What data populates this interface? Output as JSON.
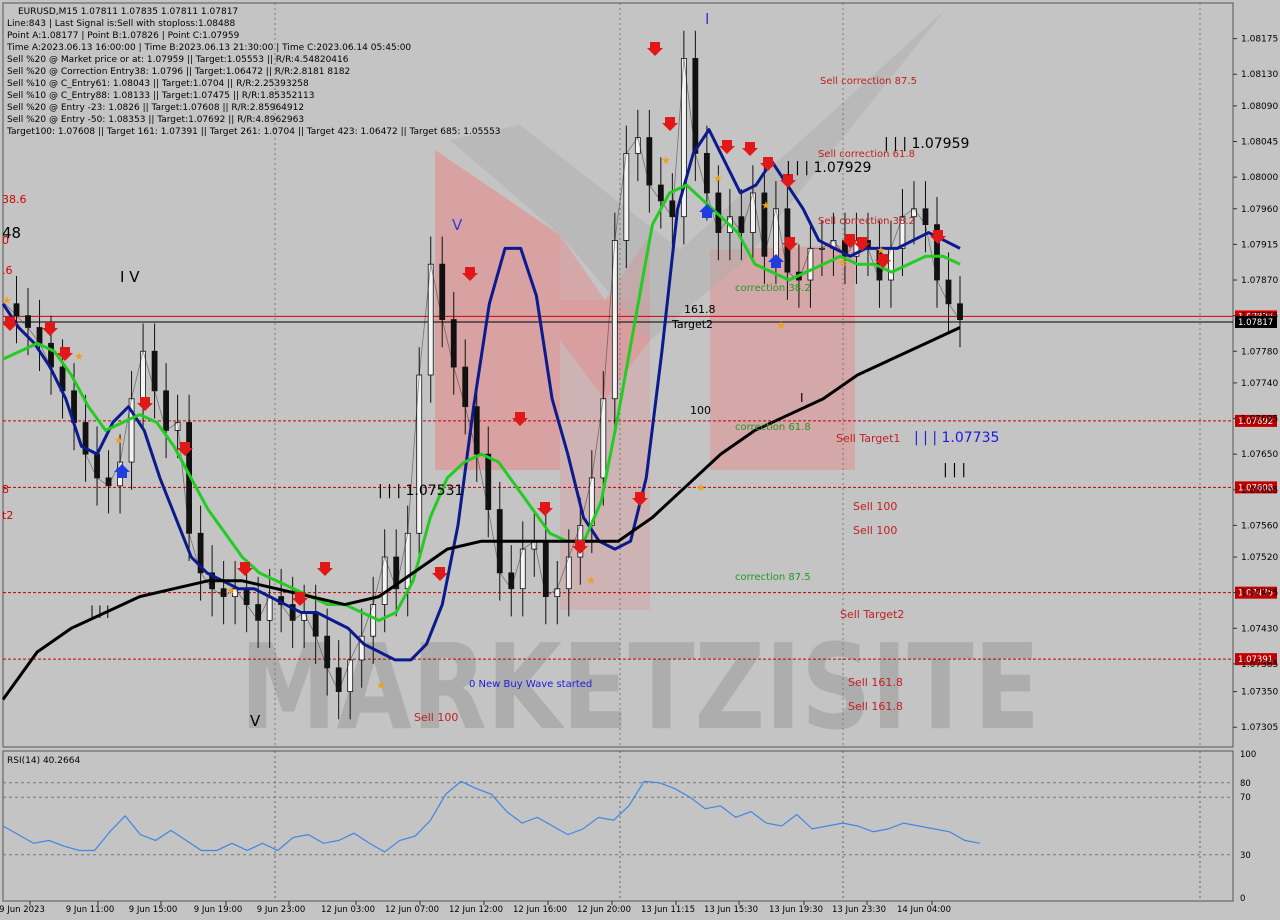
{
  "header": {
    "symbol_line": "EURUSD,M15  1.07811 1.07835 1.07811 1.07817",
    "info_lines": [
      "Line:843 | Last Signal is:Sell with stoploss:1.08488",
      "Point A:1.08177 | Point B:1.07826 | Point C:1.07959",
      "Time A:2023.06.13 16:00:00 | Time B:2023.06.13 21:30:00 | Time C:2023.06.14 05:45:00",
      "Sell %20 @ Market price or at: 1.07959 || Target:1.05553 || R/R:4.54820416",
      "Sell %20 @ Correction Entry38: 1.0796 || Target:1.06472 || R/R:2.8181 8182",
      "Sell %10 @ C_Entry61: 1.08043 || Target:1.0704 || R/R:2.25393258",
      "Sell %10 @ C_Entry88: 1.08133 || Target:1.07475 || R/R:1.85352113",
      "Sell %20 @ Entry -23: 1.0826 || Target:1.07608 || R/R:2.85964912",
      "Sell %20 @ Entry -50: 1.08353 || Target:1.07692 || R/R:4.8962963",
      "Target100: 1.07608 || Target 161: 1.07391 || Target 261: 1.0704 || Target 423: 1.06472 || Target 685: 1.05553"
    ]
  },
  "chart_data": [
    {
      "type": "line",
      "subtype": "candlestick",
      "instrument": "EURUSD",
      "timeframe": "M15",
      "ylim": [
        1.0728,
        1.0822
      ],
      "price_ticks": [
        1.08175,
        1.0813,
        1.0809,
        1.08045,
        1.08,
        1.0796,
        1.07915,
        1.0787,
        1.07825,
        1.0778,
        1.0774,
        1.07695,
        1.0765,
        1.07605,
        1.0756,
        1.0752,
        1.07475,
        1.0743,
        1.07385,
        1.0735,
        1.07305
      ],
      "price_tick_labels": [
        "1.08175",
        "1.08130",
        "1.08090",
        "1.08045",
        "1.08000",
        "1.07960",
        "1.07915",
        "1.07870",
        "1.07825",
        "1.07780",
        "1.07740",
        "1.07695",
        "1.07650",
        "1.07605",
        "1.07560",
        "1.07520",
        "1.07475",
        "1.07430",
        "1.07385",
        "1.07350",
        "1.07305"
      ],
      "time_labels": [
        "9 Jun 2023",
        "9 Jun 11:00",
        "9 Jun 15:00",
        "9 Jun 19:00",
        "9 Jun 23:00",
        "12 Jun 03:00",
        "12 Jun 07:00",
        "12 Jun 12:00",
        "12 Jun 16:00",
        "12 Jun 20:00",
        "13 Jun 11:15",
        "13 Jun 15:30",
        "13 Jun 19:30",
        "13 Jun 23:30",
        "14 Jun 04:00"
      ],
      "close_series": [
        1.0784,
        1.07825,
        1.0781,
        1.0779,
        1.0776,
        1.0773,
        1.0769,
        1.0765,
        1.0762,
        1.0761,
        1.0764,
        1.0772,
        1.0778,
        1.0773,
        1.0768,
        1.0769,
        1.0755,
        1.075,
        1.0748,
        1.0747,
        1.0748,
        1.0746,
        1.0744,
        1.0747,
        1.0746,
        1.0744,
        1.0745,
        1.0742,
        1.0738,
        1.0735,
        1.0739,
        1.0742,
        1.0746,
        1.0752,
        1.0748,
        1.0755,
        1.0775,
        1.0789,
        1.0782,
        1.0776,
        1.0771,
        1.0765,
        1.0758,
        1.075,
        1.0748,
        1.0753,
        1.0754,
        1.0747,
        1.0748,
        1.0752,
        1.0756,
        1.0762,
        1.0772,
        1.0792,
        1.0803,
        1.0805,
        1.0799,
        1.0797,
        1.0795,
        1.0815,
        1.0803,
        1.0798,
        1.0793,
        1.0795,
        1.0793,
        1.0798,
        1.079,
        1.0796,
        1.0788,
        1.0787,
        1.0791,
        1.0791,
        1.0792,
        1.079,
        1.0792,
        1.0791,
        1.0787,
        1.0791,
        1.0795,
        1.0796,
        1.0794,
        1.0787,
        1.0784,
        1.0782
      ],
      "close_series_label": "EURUSD price (approx. close)",
      "moving_averages": [
        {
          "name": "Fast MA",
          "color": "#0b1a8c",
          "values": [
            1.0784,
            1.0781,
            1.0779,
            1.0776,
            1.0772,
            1.0766,
            1.0765,
            1.0769,
            1.0771,
            1.0768,
            1.0762,
            1.0757,
            1.0752,
            1.075,
            1.0749,
            1.0748,
            1.0748,
            1.0747,
            1.0746,
            1.0745,
            1.0745,
            1.0744,
            1.0743,
            1.0741,
            1.074,
            1.0739,
            1.0739,
            1.0741,
            1.0746,
            1.0756,
            1.0771,
            1.0784,
            1.0791,
            1.0791,
            1.0785,
            1.0772,
            1.0765,
            1.0757,
            1.0754,
            1.0753,
            1.0754,
            1.0762,
            1.0778,
            1.0796,
            1.0803,
            1.0806,
            1.0802,
            1.0798,
            1.0799,
            1.0802,
            1.0799,
            1.0796,
            1.0792,
            1.0791,
            1.079,
            1.0791,
            1.0791,
            1.0791,
            1.0792,
            1.0793,
            1.0792,
            1.0791
          ]
        },
        {
          "name": "Medium MA",
          "color": "#22cc22",
          "values": [
            1.0777,
            1.0778,
            1.0779,
            1.0778,
            1.0775,
            1.0771,
            1.0768,
            1.0769,
            1.077,
            1.0769,
            1.0766,
            1.0762,
            1.0758,
            1.0755,
            1.0752,
            1.075,
            1.0749,
            1.0748,
            1.0747,
            1.0746,
            1.0746,
            1.0745,
            1.0744,
            1.0745,
            1.0749,
            1.0757,
            1.0762,
            1.0764,
            1.0765,
            1.0764,
            1.0761,
            1.0758,
            1.0755,
            1.0754,
            1.0754,
            1.0759,
            1.077,
            1.0782,
            1.0794,
            1.0798,
            1.0799,
            1.0797,
            1.0795,
            1.0793,
            1.0789,
            1.0788,
            1.0787,
            1.0788,
            1.0789,
            1.079,
            1.0789,
            1.0789,
            1.0788,
            1.0789,
            1.079,
            1.079,
            1.0789
          ]
        },
        {
          "name": "Slow MA",
          "color": "#000000",
          "values": [
            1.0734,
            1.074,
            1.0743,
            1.0745,
            1.0747,
            1.0748,
            1.0749,
            1.0749,
            1.0748,
            1.0747,
            1.0746,
            1.0747,
            1.075,
            1.0753,
            1.0754,
            1.0754,
            1.0754,
            1.0754,
            1.0754,
            1.0757,
            1.0761,
            1.0765,
            1.0768,
            1.077,
            1.0772,
            1.0775,
            1.0777,
            1.0779,
            1.0781
          ]
        }
      ],
      "horizontal_levels": [
        {
          "price": 1.07824,
          "label": "1.07824",
          "color": "#d40000",
          "style": "solid"
        },
        {
          "price": 1.07817,
          "label": "1.07817",
          "color": "#000000",
          "style": "solid",
          "current": true
        },
        {
          "price": 1.07692,
          "label": "1.07692",
          "color": "#c00000",
          "style": "dashed"
        },
        {
          "price": 1.07608,
          "label": "1.07608",
          "color": "#c00000",
          "style": "dashed"
        },
        {
          "price": 1.07475,
          "label": "1.07475",
          "color": "#c00000",
          "style": "dashed"
        },
        {
          "price": 1.07391,
          "label": "1.07391",
          "color": "#c00000",
          "style": "dashed"
        }
      ],
      "annotations": [
        {
          "text": "Sell correction 87.5",
          "color": "#c02020"
        },
        {
          "text": "Sell correction 61.8",
          "color": "#c02020"
        },
        {
          "text": "Sell correction 38.2",
          "color": "#c02020"
        },
        {
          "text": "| | | 1.07959",
          "color": "#000000"
        },
        {
          "text": "| | | 1.07929",
          "color": "#000000"
        },
        {
          "text": "| | | 1.07735",
          "color": "#1a1ae0"
        },
        {
          "text": "| | | 1.07531",
          "color": "#000000"
        },
        {
          "text": "161.8",
          "color": "#000000"
        },
        {
          "text": "Target2",
          "color": "#000000"
        },
        {
          "text": "100",
          "color": "#000000"
        },
        {
          "text": "correction 38.2",
          "color": "#229922"
        },
        {
          "text": "correction 61.8",
          "color": "#229922"
        },
        {
          "text": "correction 87.5",
          "color": "#229922"
        },
        {
          "text": "Sell Target1",
          "color": "#c02020"
        },
        {
          "text": "Sell 100",
          "color": "#c02020"
        },
        {
          "text": "Sell 100",
          "color": "#c02020"
        },
        {
          "text": "Sell Target2",
          "color": "#c02020"
        },
        {
          "text": "Sell 161.8",
          "color": "#c02020"
        },
        {
          "text": "Sell 161.8",
          "color": "#c02020"
        },
        {
          "text": "Sell 100",
          "color": "#c02020"
        },
        {
          "text": "0 New Buy Wave started",
          "color": "#1a1ae0"
        },
        {
          "text": "I V",
          "color": "#000000"
        },
        {
          "text": "V",
          "color": "#000000"
        },
        {
          "text": "V",
          "color": "#3a3ad0"
        },
        {
          "text": "I",
          "color": "#3a3ad0"
        },
        {
          "text": "I",
          "color": "#000000"
        },
        {
          "text": "| | |",
          "color": "#000000"
        },
        {
          "text": "| | |",
          "color": "#000000"
        },
        {
          "text": "38.6",
          "color": "#d40000"
        },
        {
          "text": "0",
          "color": "#d40000"
        },
        {
          "text": "48",
          "color": "#000000"
        },
        {
          "text": ".6",
          "color": "#d40000"
        },
        {
          "text": "8",
          "color": "#d40000"
        },
        {
          "text": "t2",
          "color": "#d40000"
        }
      ],
      "watermark": "MARKETZISITE"
    },
    {
      "type": "line",
      "title": "RSI(14) 40.2664",
      "series": [
        {
          "name": "RSI(14)",
          "color": "#3f86e6",
          "values": [
            50,
            44,
            38,
            40,
            36,
            33,
            33,
            46,
            57,
            44,
            40,
            47,
            40,
            33,
            33,
            38,
            33,
            38,
            33,
            42,
            44,
            38,
            40,
            45,
            38,
            32,
            40,
            43,
            54,
            72,
            81,
            76,
            72,
            60,
            52,
            56,
            50,
            44,
            48,
            56,
            54,
            64,
            81,
            80,
            76,
            70,
            62,
            64,
            56,
            60,
            52,
            50,
            58,
            48,
            50,
            52,
            50,
            46,
            48,
            52,
            50,
            48,
            46,
            40,
            38
          ]
        }
      ],
      "ylim": [
        0,
        100
      ],
      "ticks": [
        100,
        80,
        70,
        30,
        0
      ],
      "levels": [
        80,
        70,
        30
      ]
    }
  ]
}
